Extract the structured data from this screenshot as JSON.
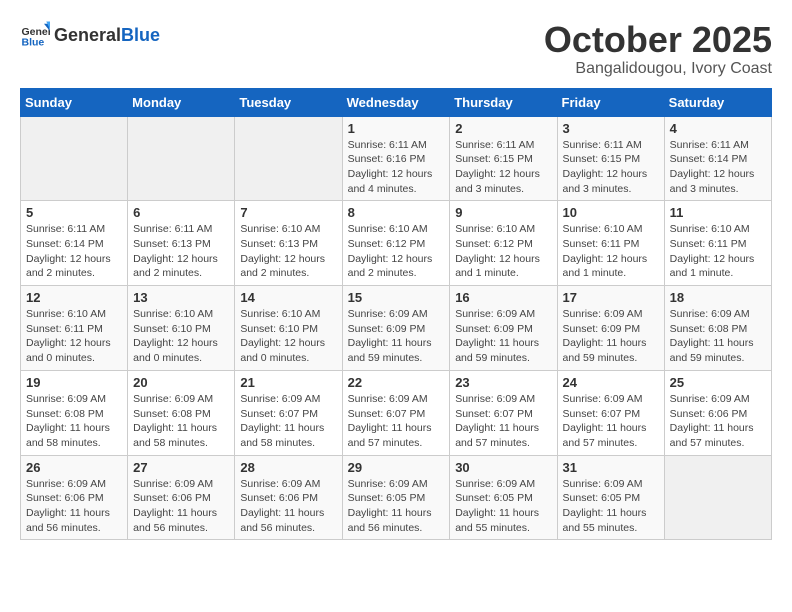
{
  "logo": {
    "general": "General",
    "blue": "Blue"
  },
  "title": "October 2025",
  "subtitle": "Bangalidougou, Ivory Coast",
  "days_of_week": [
    "Sunday",
    "Monday",
    "Tuesday",
    "Wednesday",
    "Thursday",
    "Friday",
    "Saturday"
  ],
  "weeks": [
    [
      {
        "day": "",
        "info": ""
      },
      {
        "day": "",
        "info": ""
      },
      {
        "day": "",
        "info": ""
      },
      {
        "day": "1",
        "info": "Sunrise: 6:11 AM\nSunset: 6:16 PM\nDaylight: 12 hours\nand 4 minutes."
      },
      {
        "day": "2",
        "info": "Sunrise: 6:11 AM\nSunset: 6:15 PM\nDaylight: 12 hours\nand 3 minutes."
      },
      {
        "day": "3",
        "info": "Sunrise: 6:11 AM\nSunset: 6:15 PM\nDaylight: 12 hours\nand 3 minutes."
      },
      {
        "day": "4",
        "info": "Sunrise: 6:11 AM\nSunset: 6:14 PM\nDaylight: 12 hours\nand 3 minutes."
      }
    ],
    [
      {
        "day": "5",
        "info": "Sunrise: 6:11 AM\nSunset: 6:14 PM\nDaylight: 12 hours\nand 2 minutes."
      },
      {
        "day": "6",
        "info": "Sunrise: 6:11 AM\nSunset: 6:13 PM\nDaylight: 12 hours\nand 2 minutes."
      },
      {
        "day": "7",
        "info": "Sunrise: 6:10 AM\nSunset: 6:13 PM\nDaylight: 12 hours\nand 2 minutes."
      },
      {
        "day": "8",
        "info": "Sunrise: 6:10 AM\nSunset: 6:12 PM\nDaylight: 12 hours\nand 2 minutes."
      },
      {
        "day": "9",
        "info": "Sunrise: 6:10 AM\nSunset: 6:12 PM\nDaylight: 12 hours\nand 1 minute."
      },
      {
        "day": "10",
        "info": "Sunrise: 6:10 AM\nSunset: 6:11 PM\nDaylight: 12 hours\nand 1 minute."
      },
      {
        "day": "11",
        "info": "Sunrise: 6:10 AM\nSunset: 6:11 PM\nDaylight: 12 hours\nand 1 minute."
      }
    ],
    [
      {
        "day": "12",
        "info": "Sunrise: 6:10 AM\nSunset: 6:11 PM\nDaylight: 12 hours\nand 0 minutes."
      },
      {
        "day": "13",
        "info": "Sunrise: 6:10 AM\nSunset: 6:10 PM\nDaylight: 12 hours\nand 0 minutes."
      },
      {
        "day": "14",
        "info": "Sunrise: 6:10 AM\nSunset: 6:10 PM\nDaylight: 12 hours\nand 0 minutes."
      },
      {
        "day": "15",
        "info": "Sunrise: 6:09 AM\nSunset: 6:09 PM\nDaylight: 11 hours\nand 59 minutes."
      },
      {
        "day": "16",
        "info": "Sunrise: 6:09 AM\nSunset: 6:09 PM\nDaylight: 11 hours\nand 59 minutes."
      },
      {
        "day": "17",
        "info": "Sunrise: 6:09 AM\nSunset: 6:09 PM\nDaylight: 11 hours\nand 59 minutes."
      },
      {
        "day": "18",
        "info": "Sunrise: 6:09 AM\nSunset: 6:08 PM\nDaylight: 11 hours\nand 59 minutes."
      }
    ],
    [
      {
        "day": "19",
        "info": "Sunrise: 6:09 AM\nSunset: 6:08 PM\nDaylight: 11 hours\nand 58 minutes."
      },
      {
        "day": "20",
        "info": "Sunrise: 6:09 AM\nSunset: 6:08 PM\nDaylight: 11 hours\nand 58 minutes."
      },
      {
        "day": "21",
        "info": "Sunrise: 6:09 AM\nSunset: 6:07 PM\nDaylight: 11 hours\nand 58 minutes."
      },
      {
        "day": "22",
        "info": "Sunrise: 6:09 AM\nSunset: 6:07 PM\nDaylight: 11 hours\nand 57 minutes."
      },
      {
        "day": "23",
        "info": "Sunrise: 6:09 AM\nSunset: 6:07 PM\nDaylight: 11 hours\nand 57 minutes."
      },
      {
        "day": "24",
        "info": "Sunrise: 6:09 AM\nSunset: 6:07 PM\nDaylight: 11 hours\nand 57 minutes."
      },
      {
        "day": "25",
        "info": "Sunrise: 6:09 AM\nSunset: 6:06 PM\nDaylight: 11 hours\nand 57 minutes."
      }
    ],
    [
      {
        "day": "26",
        "info": "Sunrise: 6:09 AM\nSunset: 6:06 PM\nDaylight: 11 hours\nand 56 minutes."
      },
      {
        "day": "27",
        "info": "Sunrise: 6:09 AM\nSunset: 6:06 PM\nDaylight: 11 hours\nand 56 minutes."
      },
      {
        "day": "28",
        "info": "Sunrise: 6:09 AM\nSunset: 6:06 PM\nDaylight: 11 hours\nand 56 minutes."
      },
      {
        "day": "29",
        "info": "Sunrise: 6:09 AM\nSunset: 6:05 PM\nDaylight: 11 hours\nand 56 minutes."
      },
      {
        "day": "30",
        "info": "Sunrise: 6:09 AM\nSunset: 6:05 PM\nDaylight: 11 hours\nand 55 minutes."
      },
      {
        "day": "31",
        "info": "Sunrise: 6:09 AM\nSunset: 6:05 PM\nDaylight: 11 hours\nand 55 minutes."
      },
      {
        "day": "",
        "info": ""
      }
    ]
  ]
}
